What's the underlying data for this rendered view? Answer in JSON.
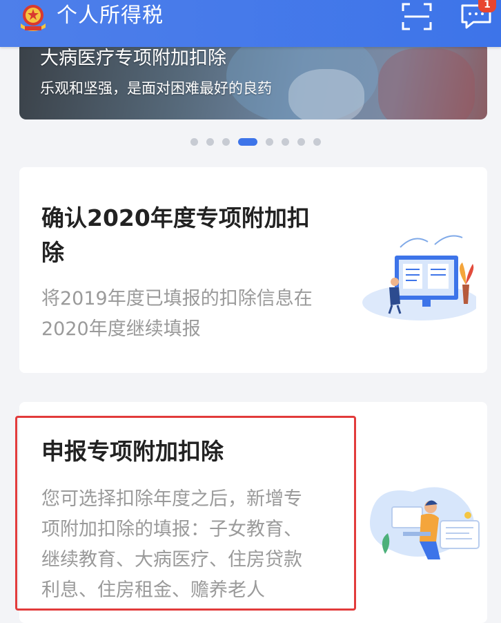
{
  "header": {
    "title": "个人所得税",
    "icons": {
      "emblem": "tax-emblem-icon",
      "scan": "scan-icon",
      "message": "message-icon"
    },
    "message_badge": "1",
    "colors": {
      "bar": "#3d74e9",
      "badge": "#e8452f"
    }
  },
  "banner": {
    "title": "大病医疗专项附加扣除",
    "subtitle": "乐观和坚强，是面对困难最好的良药",
    "page_count": 8,
    "active_index": 3
  },
  "cards": [
    {
      "title_line1": "确认2020年度专项附加扣",
      "title_line2": "除",
      "desc_line1": "将2019年度已填报的扣除信息在",
      "desc_line2": "2020年度继续填报",
      "illustration": "computer-desk-illustration"
    },
    {
      "title": "申报专项附加扣除",
      "desc_line1": "您可选择扣除年度之后，新增专",
      "desc_line2": "项附加扣除的填报：子女教育、",
      "desc_line3": "继续教育、大病医疗、住房贷款",
      "desc_line4": "利息、住房租金、赡养老人",
      "illustration": "person-laptop-illustration",
      "highlight_color": "#e23b3b"
    }
  ]
}
